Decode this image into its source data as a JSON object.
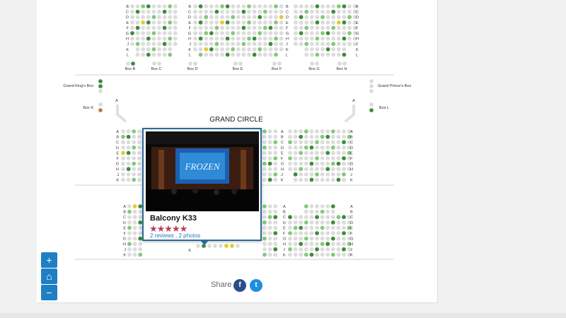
{
  "colors": {
    "seat_unavailable": "#dcdcdc",
    "seat_available": "#3c8c3c",
    "seat_light": "#86c77e",
    "seat_yellow": "#e3cb2e",
    "seat_box_k": "#c07a3b",
    "accent": "#1f7fc4"
  },
  "stalls_rows": [
    "B",
    "C",
    "D",
    "E",
    "F",
    "G",
    "H",
    "J",
    "K",
    "L"
  ],
  "boxes_top": [
    "Box B",
    "Box C",
    "Box D",
    "Box E",
    "Box F",
    "Box G",
    "Box H"
  ],
  "side_boxes": {
    "left_name": "Grand King's Box",
    "right_name": "Grand Prince's Box",
    "left_k": "Box K",
    "right_l": "Box L"
  },
  "grand_circle": {
    "title": "GRAND CIRCLE",
    "rows": [
      "A",
      "B",
      "C",
      "D",
      "E",
      "F",
      "G",
      "H",
      "J",
      "K"
    ]
  },
  "balcony_rows": [
    "A",
    "B",
    "C",
    "D",
    "E",
    "F",
    "G",
    "H",
    "J",
    "K"
  ],
  "popup": {
    "title": "Balcony K33",
    "stars": "★★★★★",
    "reviews": "2 reviews",
    "separator": " , ",
    "photos": "2 photos",
    "photo_text": "FROZEN"
  },
  "zoom_controls": {
    "zoom_in": "+",
    "home": "⌂",
    "zoom_out": "−"
  },
  "share": {
    "label": "Share",
    "facebook": "f",
    "twitter": "t"
  }
}
